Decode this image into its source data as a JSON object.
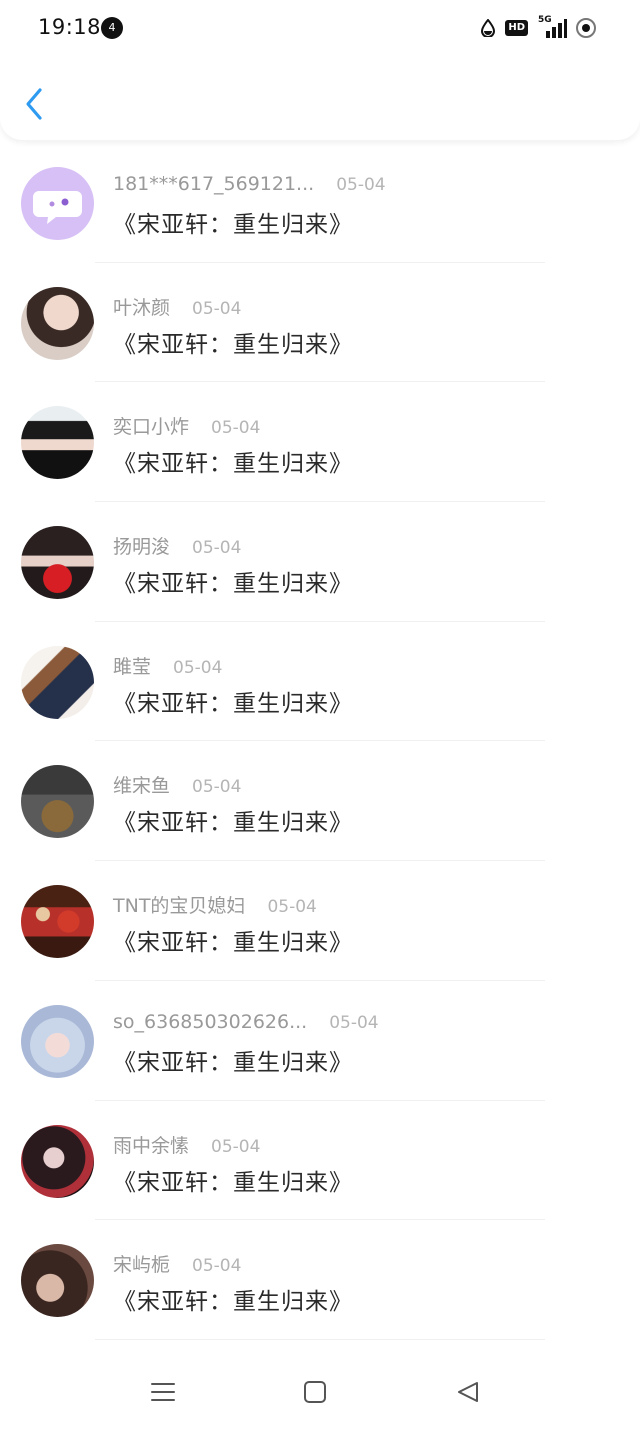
{
  "status_bar": {
    "time": "19:18",
    "notif_badge": "4",
    "hd_label": "HD",
    "network_label": "5G"
  },
  "header": {
    "back_icon": "chevron-left-icon",
    "accent": "#2f9bf0"
  },
  "rows": [
    {
      "name": "181***617_569121...",
      "date": "05-04",
      "title": "《宋亚轩：重生归来》",
      "avatar": "chat-bubble-avatar"
    },
    {
      "name": "叶沐颜",
      "date": "05-04",
      "title": "《宋亚轩：重生归来》",
      "avatar": "photo-avatar"
    },
    {
      "name": "奕口小炸",
      "date": "05-04",
      "title": "《宋亚轩：重生归来》",
      "avatar": "photo-avatar"
    },
    {
      "name": "扬明浚",
      "date": "05-04",
      "title": "《宋亚轩：重生归来》",
      "avatar": "photo-avatar"
    },
    {
      "name": "雎莹",
      "date": "05-04",
      "title": "《宋亚轩：重生归来》",
      "avatar": "photo-avatar"
    },
    {
      "name": "维宋鱼",
      "date": "05-04",
      "title": "《宋亚轩：重生归来》",
      "avatar": "photo-avatar"
    },
    {
      "name": "TNT的宝贝媳妇",
      "date": "05-04",
      "title": "《宋亚轩：重生归来》",
      "avatar": "photo-avatar"
    },
    {
      "name": "so_636850302626...",
      "date": "05-04",
      "title": "《宋亚轩：重生归来》",
      "avatar": "photo-avatar"
    },
    {
      "name": "雨中余愫",
      "date": "05-04",
      "title": "《宋亚轩：重生归来》",
      "avatar": "photo-avatar"
    },
    {
      "name": "宋屿栀",
      "date": "05-04",
      "title": "《宋亚轩：重生归来》",
      "avatar": "photo-avatar"
    }
  ],
  "navbar": {
    "icons": [
      "menu-icon",
      "home-square-icon",
      "back-triangle-icon"
    ]
  }
}
